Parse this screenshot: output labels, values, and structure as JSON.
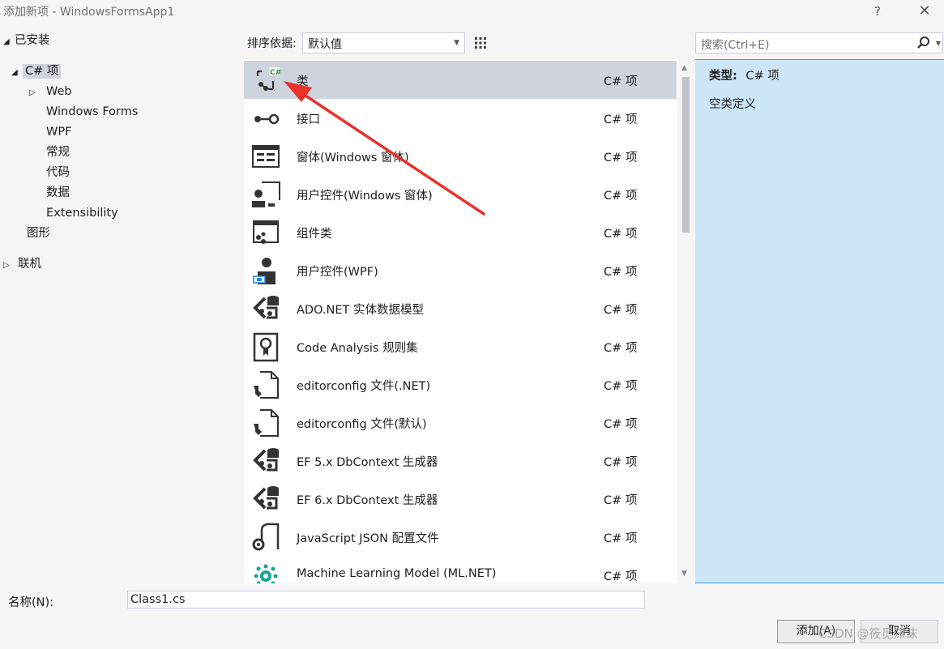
{
  "window": {
    "title": "添加新项 - WindowsFormsApp1",
    "help_label": "?",
    "close_label": "✕"
  },
  "tree": {
    "installed": "已安装",
    "csharp": "C# 项",
    "children": [
      "Web",
      "Windows Forms",
      "WPF",
      "常规",
      "代码",
      "数据",
      "Extensibility"
    ],
    "graphics": "图形",
    "online": "联机"
  },
  "toolbar": {
    "sort_label": "排序依据:",
    "sort_value": "默认值",
    "search_placeholder": "搜索(Ctrl+E)"
  },
  "items": [
    {
      "name": "类",
      "type": "C# 项",
      "icon": "class-icon",
      "selected": true
    },
    {
      "name": "接口",
      "type": "C# 项",
      "icon": "interface-icon"
    },
    {
      "name": "窗体(Windows 窗体)",
      "type": "C# 项",
      "icon": "form-icon"
    },
    {
      "name": "用户控件(Windows 窗体)",
      "type": "C# 项",
      "icon": "user-control-icon"
    },
    {
      "name": "组件类",
      "type": "C# 项",
      "icon": "component-icon"
    },
    {
      "name": "用户控件(WPF)",
      "type": "C# 项",
      "icon": "wpf-user-control-icon"
    },
    {
      "name": "ADO.NET 实体数据模型",
      "type": "C# 项",
      "icon": "entity-model-icon"
    },
    {
      "name": "Code Analysis 规则集",
      "type": "C# 项",
      "icon": "ruleset-icon"
    },
    {
      "name": "editorconfig 文件(.NET)",
      "type": "C# 项",
      "icon": "editorconfig-icon"
    },
    {
      "name": "editorconfig 文件(默认)",
      "type": "C# 项",
      "icon": "editorconfig-icon"
    },
    {
      "name": "EF 5.x DbContext 生成器",
      "type": "C# 项",
      "icon": "dbcontext-icon"
    },
    {
      "name": "EF 6.x DbContext 生成器",
      "type": "C# 项",
      "icon": "dbcontext-icon"
    },
    {
      "name": "JavaScript JSON 配置文件",
      "type": "C# 项",
      "icon": "json-config-icon"
    },
    {
      "name": "Machine Learning Model (ML.NET)",
      "type": "C# 项",
      "icon": "ml-model-icon"
    }
  ],
  "details": {
    "type_label": "类型:",
    "type_value": "C# 项",
    "description": "空类定义"
  },
  "bottom": {
    "name_label": "名称(N):",
    "name_value": "Class1.cs",
    "add_label": "添加(A)",
    "cancel_label": "取消",
    "watermark": "CSDN @筱觅沫沫"
  },
  "colors": {
    "selection": "#cfd3dd",
    "arrow": "#e8322b",
    "accent_border": "#3399ff"
  }
}
